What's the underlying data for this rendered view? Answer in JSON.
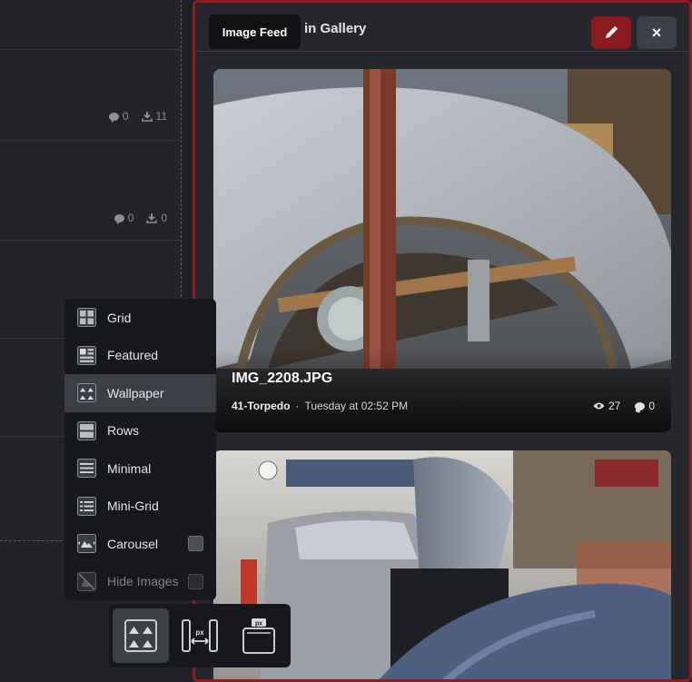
{
  "left_list": {
    "rows": [
      {
        "comments": "0",
        "downloads": "11"
      },
      {
        "comments": "0",
        "downloads": "0"
      }
    ]
  },
  "panel": {
    "title": "in Gallery",
    "tooltip": "Image Feed",
    "close_label": "×",
    "cards": [
      {
        "name": "IMG_2208.JPG",
        "author": "41-Torpedo",
        "separator": "·",
        "date": "Tuesday at 02:52 PM",
        "views": "27",
        "comments": "0"
      }
    ]
  },
  "layout_menu": {
    "items": [
      {
        "label": "Grid",
        "icon": "grid-icon",
        "active": false
      },
      {
        "label": "Featured",
        "icon": "featured-icon",
        "active": false
      },
      {
        "label": "Wallpaper",
        "icon": "wallpaper-icon",
        "active": true
      },
      {
        "label": "Rows",
        "icon": "rows-icon",
        "active": false
      },
      {
        "label": "Minimal",
        "icon": "minimal-icon",
        "active": false
      },
      {
        "label": "Mini-Grid",
        "icon": "mini-grid-icon",
        "active": false
      },
      {
        "label": "Carousel",
        "icon": "carousel-icon",
        "active": false,
        "checkbox": true
      },
      {
        "label": "Hide Images",
        "icon": "hide-images-icon",
        "active": false,
        "checkbox": true,
        "dim": true
      }
    ]
  },
  "toolbar": {
    "buttons": [
      {
        "icon": "wallpaper-layout-icon",
        "active": true
      },
      {
        "icon": "width-px-icon",
        "active": false
      },
      {
        "icon": "height-px-icon",
        "active": false
      }
    ],
    "px_label": "px"
  },
  "colors": {
    "accent": "#8b1a1f",
    "panel_border": "#8f1d22",
    "background": "#1f2127"
  }
}
